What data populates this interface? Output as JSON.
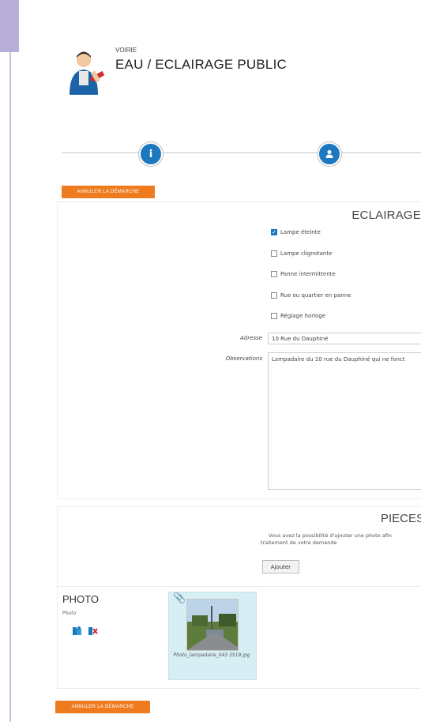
{
  "header": {
    "category": "VOIRIE",
    "title": "EAU / ECLAIRAGE PUBLIC"
  },
  "stepper": {
    "step1_icon": "i",
    "step2_icon": "user-icon"
  },
  "buttons": {
    "cancel_top": "ANNULER LA DÉMARCHE",
    "cancel_bottom": "ANNULER LA DÉMARCHE",
    "add": "Ajouter"
  },
  "eclairage": {
    "title": "ECLAIRAGE",
    "options": [
      {
        "label": "Lampe éteinte",
        "checked": true
      },
      {
        "label": "Lampe clignotante",
        "checked": false
      },
      {
        "label": "Panne intermittente",
        "checked": false
      },
      {
        "label": "Rue ou quartier en panne",
        "checked": false
      },
      {
        "label": "Réglage horloge",
        "checked": false
      }
    ],
    "adresse_label": "Adresse",
    "adresse_value": "10 Rue du Dauphiné",
    "observations_label": "Observations",
    "observations_value": "Lampadaire du 10 rue du Dauphiné qui ne fonct"
  },
  "pieces": {
    "title": "PIECES J",
    "help_line1": "Vous avez la possibilité d'ajouter une photo afin",
    "help_line2": "traitement de votre demande"
  },
  "photo": {
    "label": "PHOTO",
    "sublabel": "Photo",
    "filename": "Photo_lampadaire_043 3519.jpg"
  }
}
